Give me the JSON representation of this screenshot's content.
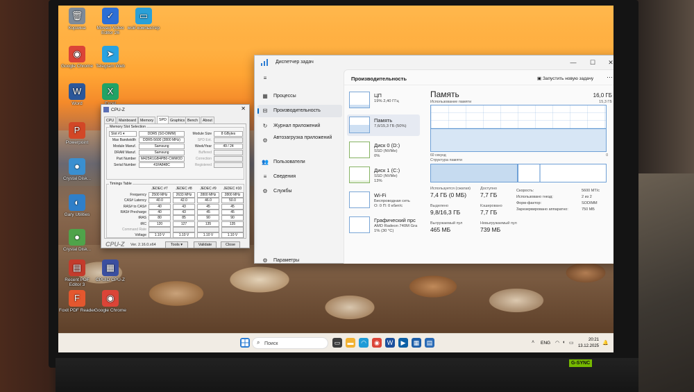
{
  "desktop": {
    "icons": [
      {
        "label": "Корзина",
        "glyph": "🗑",
        "color": "#7d8a99"
      },
      {
        "label": "Movavi Video Editor 26",
        "glyph": "✓",
        "color": "#2c6fd6"
      },
      {
        "label": "мой компьютер",
        "glyph": "▭",
        "color": "#2aa0d8"
      },
      {
        "label": "Google Chrome",
        "glyph": "◉",
        "color": "#db4437"
      },
      {
        "label": "Telegram Web",
        "glyph": "➤",
        "color": "#2aa2e0"
      },
      {
        "label": "Word",
        "glyph": "W",
        "color": "#2b579a"
      },
      {
        "label": "Excel",
        "glyph": "X",
        "color": "#21a366"
      },
      {
        "label": "Powerpoint",
        "glyph": "P",
        "color": "#d24726"
      },
      {
        "label": "Crystal Disk...",
        "glyph": "●",
        "color": "#3a8fd0"
      },
      {
        "label": "Gary Utilities",
        "glyph": "◐",
        "color": "#2f7fc9"
      },
      {
        "label": "Crystal Disk...",
        "glyph": "●",
        "color": "#4fa34a"
      },
      {
        "label": "Recent PDF Editor 3",
        "glyph": "▤",
        "color": "#c43b2c"
      },
      {
        "label": "CPUID CPU-Z",
        "glyph": "▦",
        "color": "#3a4fa0"
      },
      {
        "label": "Foxit PDF Reader",
        "glyph": "F",
        "color": "#e4572e"
      },
      {
        "label": "Google Chrome",
        "glyph": "◉",
        "color": "#db4437"
      }
    ]
  },
  "taskmgr": {
    "title": "Диспетчер задач",
    "controls": {
      "minimize": "—",
      "maximize": "☐",
      "close": "✕"
    },
    "nav": [
      {
        "label": "Процессы",
        "icon": "▦"
      },
      {
        "label": "Производительность",
        "icon": "⊟"
      },
      {
        "label": "Журнал приложений",
        "icon": "↻"
      },
      {
        "label": "Автозагрузка приложений",
        "icon": "⚙"
      },
      {
        "label": "Пользователи",
        "icon": "👥"
      },
      {
        "label": "Сведения",
        "icon": "≡"
      },
      {
        "label": "Службы",
        "icon": "⚙"
      }
    ],
    "settings_label": "Параметры",
    "settings_icon": "⚙",
    "header": {
      "title": "Производительность",
      "run_task": "Запустить новую задачу",
      "more": "⋯"
    },
    "resources": [
      {
        "name": "ЦП",
        "line2": "19% 2,40 ГГц",
        "line3": "",
        "level": 0.19
      },
      {
        "name": "Память",
        "line2": "7,6/15,3 ГБ (50%)",
        "line3": "",
        "level": 0.5
      },
      {
        "name": "Диск 0 (D:)",
        "line2": "SSD (NVMe)",
        "line3": "0%",
        "level": 0.0
      },
      {
        "name": "Диск 1 (C:)",
        "line2": "SSD (NVMe)",
        "line3": "13%",
        "level": 0.13
      },
      {
        "name": "Wi-Fi",
        "line2": "Беспроводная сеть",
        "line3": "О: 0 П: 0 кбит/с",
        "level": 0.0
      },
      {
        "name": "Графический прс",
        "line2": "AMD Radeon 740M Gra",
        "line3": "1% (30 °C)",
        "level": 0.01
      }
    ],
    "memory": {
      "title": "Память",
      "total": "16,0 ГБ",
      "usage_label": "Использование памяти",
      "usage_max": "15,3 ГБ",
      "usage_level": 0.5,
      "axis_left": "60 секунд",
      "axis_right": "0",
      "structure_label": "Структура памяти",
      "structure_used": 0.5,
      "stats": {
        "in_use_label": "Используется (сжатая)",
        "in_use": "7,4 ГБ (0 МБ)",
        "available_label": "Доступно",
        "available": "7,7 ГБ",
        "committed_label": "Выделено",
        "committed": "9,8/16,3 ГБ",
        "cached_label": "Кэшировано",
        "cached": "7,7 ГБ",
        "paged_label": "Выгружаемый пул",
        "paged": "465 МБ",
        "nonpaged_label": "Невыгружаемый пул",
        "nonpaged": "739 МБ"
      },
      "specs": [
        {
          "k": "Скорость:",
          "v": "5600 МТ/с"
        },
        {
          "k": "Использовано гнезд:",
          "v": "2 из 2"
        },
        {
          "k": "Форм-фактор:",
          "v": "SODIMM"
        },
        {
          "k": "Зарезервировано аппаратно:",
          "v": "750 МБ"
        }
      ]
    }
  },
  "cpuz": {
    "title": "CPU-Z",
    "close": "✕",
    "tabs": [
      "CPU",
      "Mainboard",
      "Memory",
      "SPD",
      "Graphics",
      "Bench",
      "About"
    ],
    "slot_group": "Memory Slot Selection",
    "slot": "Slot #1",
    "module_type": "DDR5 (SO-DIMM)",
    "module_size_label": "Module Size",
    "module_size": "8 GBytes",
    "max_bw_label": "Max Bandwidth",
    "max_bw": "DDR5-5600 (2800 MHz)",
    "spd_ext_label": "SPD Ext.",
    "manuf_label": "Module Manuf.",
    "manuf": "Samsung",
    "week_label": "Week/Year",
    "week": "49 / 24",
    "dram_label": "DRAM Manuf.",
    "dram": "Samsung",
    "buffered_label": "Buffered",
    "part_label": "Part Number",
    "part": "M425R1GB4PB0-CWMOD",
    "correction_label": "Correction",
    "serial_label": "Serial Number",
    "serial": "41FA848C",
    "registered_label": "Registered",
    "timings_group": "Timings Table",
    "timings_cols": [
      "JEDEC #7",
      "JEDEC #8",
      "JEDEC #9",
      "JEDEC #10"
    ],
    "timings": [
      {
        "label": "Frequency",
        "vals": [
          "2500 MHz",
          "2633 MHz",
          "2800 MHz",
          "2800 MHz"
        ]
      },
      {
        "label": "CAS# Latency",
        "vals": [
          "40.0",
          "42.0",
          "46.0",
          "50.0"
        ]
      },
      {
        "label": "RAS# to CAS#",
        "vals": [
          "40",
          "43",
          "45",
          "45"
        ]
      },
      {
        "label": "RAS# Precharge",
        "vals": [
          "40",
          "43",
          "45",
          "45"
        ]
      },
      {
        "label": "tRAS",
        "vals": [
          "80",
          "85",
          "90",
          "90"
        ]
      },
      {
        "label": "tRC",
        "vals": [
          "120",
          "127",
          "135",
          "135"
        ]
      },
      {
        "label": "Command Rate",
        "vals": [
          "",
          "",
          "",
          ""
        ]
      },
      {
        "label": "Voltage",
        "vals": [
          "1.10 V",
          "1.10 V",
          "1.10 V",
          "1.10 V"
        ]
      }
    ],
    "brand": "CPU-Z",
    "version": "Ver. 2.16.0.x64",
    "tools": "Tools",
    "validate": "Validate",
    "close_btn": "Close"
  },
  "taskbar": {
    "search_placeholder": "Поиск",
    "lang": "ENG",
    "time": "20:21",
    "date": "13.12.2025"
  },
  "stickers": {
    "nvidia": "G-SYNC"
  }
}
